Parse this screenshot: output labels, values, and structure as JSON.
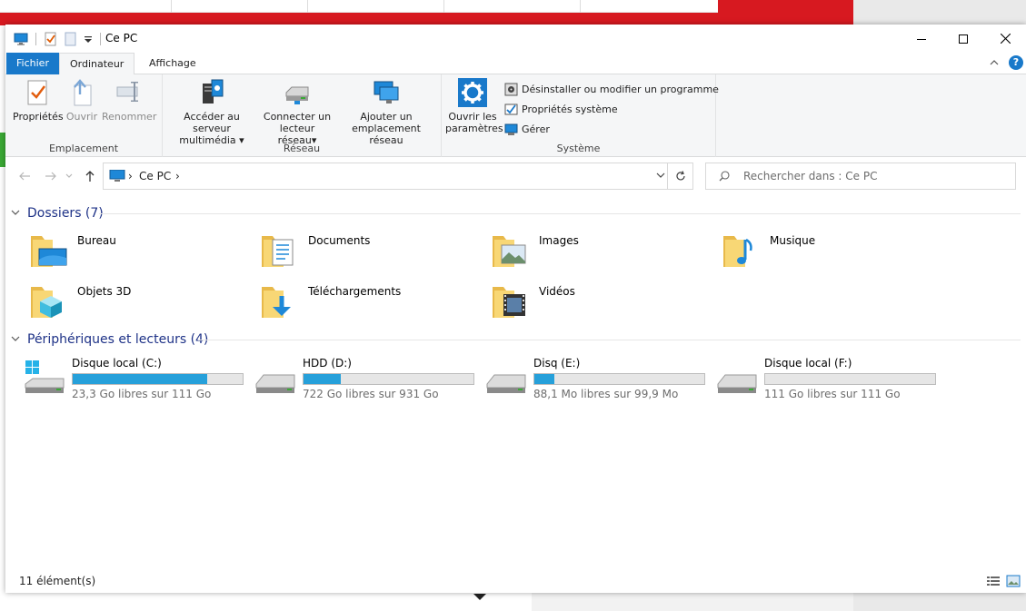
{
  "window": {
    "title": "Ce PC",
    "tabs": {
      "file": "Fichier",
      "computer": "Ordinateur",
      "view": "Affichage"
    },
    "help": "?"
  },
  "ribbon": {
    "location": {
      "label": "Emplacement",
      "properties": "Propriétés",
      "open": "Ouvrir",
      "rename": "Renommer"
    },
    "network": {
      "label": "Réseau",
      "media_line1": "Accéder au serveur",
      "media_line2": "multimédia",
      "map_line1": "Connecter un",
      "map_line2": "lecteur réseau",
      "add_line1": "Ajouter un",
      "add_line2": "emplacement réseau"
    },
    "system": {
      "label": "Système",
      "settings_line1": "Ouvrir les",
      "settings_line2": "paramètres",
      "uninstall": "Désinstaller ou modifier un programme",
      "sys_props": "Propriétés système",
      "manage": "Gérer"
    }
  },
  "address": {
    "crumb": "Ce PC",
    "search_placeholder": "Rechercher dans : Ce PC"
  },
  "folders_section": {
    "title": "Dossiers (7)",
    "items": [
      {
        "name": "Bureau",
        "icon": "desktop-folder-icon"
      },
      {
        "name": "Documents",
        "icon": "documents-folder-icon"
      },
      {
        "name": "Images",
        "icon": "pictures-folder-icon"
      },
      {
        "name": "Musique",
        "icon": "music-folder-icon"
      },
      {
        "name": "Objets 3D",
        "icon": "3d-objects-folder-icon"
      },
      {
        "name": "Téléchargements",
        "icon": "downloads-folder-icon"
      },
      {
        "name": "Vidéos",
        "icon": "videos-folder-icon"
      }
    ]
  },
  "drives_section": {
    "title": "Périphériques et lecteurs (4)",
    "items": [
      {
        "name": "Disque local (C:)",
        "free": "23,3 Go libres sur 111 Go",
        "used_fraction": 0.79,
        "icon": "windows-drive-icon"
      },
      {
        "name": "HDD (D:)",
        "free": "722 Go libres sur 931 Go",
        "used_fraction": 0.22,
        "icon": "hard-drive-icon"
      },
      {
        "name": "Disq (E:)",
        "free": "88,1 Mo libres sur 99,9 Mo",
        "used_fraction": 0.12,
        "icon": "hard-drive-icon"
      },
      {
        "name": "Disque local (F:)",
        "free": "111 Go libres sur 111 Go",
        "used_fraction": 0.0,
        "icon": "hard-drive-icon"
      }
    ]
  },
  "status": {
    "count": "11 élément(s)"
  },
  "colors": {
    "accent": "#1979ca",
    "bar_fill": "#26a0da",
    "section_title": "#1e3287",
    "folder": "#f8d775"
  }
}
